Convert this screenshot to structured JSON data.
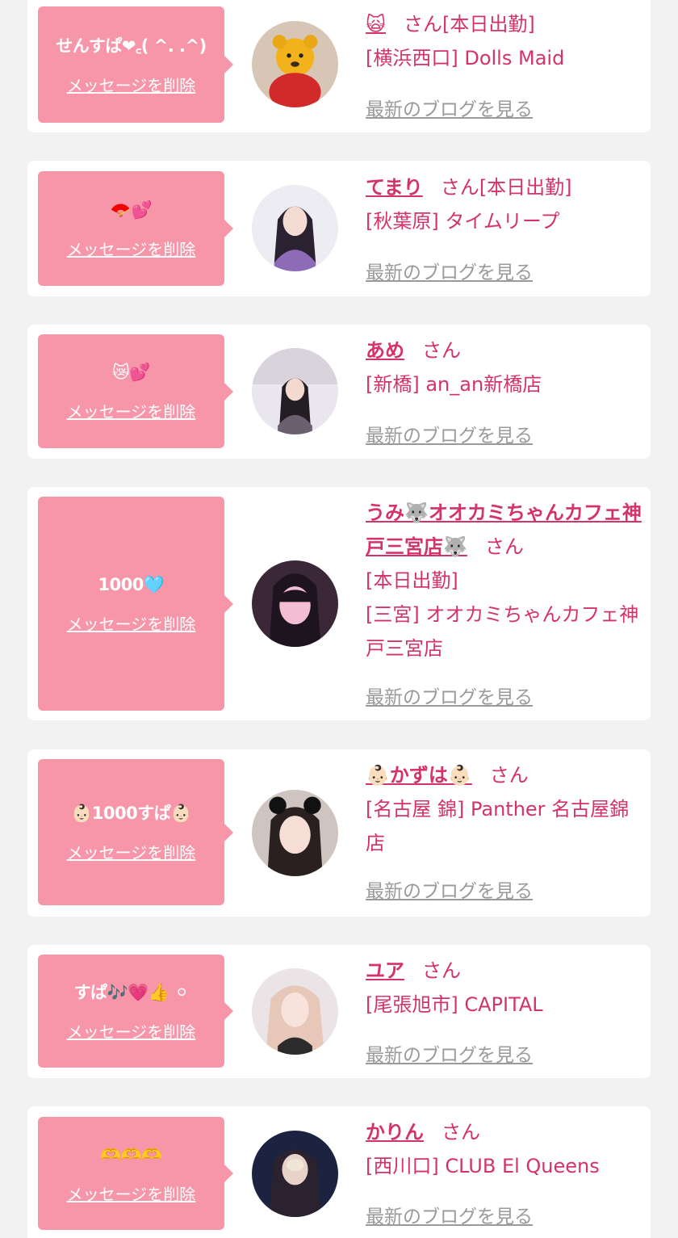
{
  "delete_label": "メッセージを削除",
  "blog_label": "最新のブログを見る",
  "honorific": "さん",
  "colors": {
    "page_bg": "#f2f2f2",
    "bubble": "#f795a9",
    "accent": "#d4336a",
    "muted": "#9a9a9a"
  },
  "entries": [
    {
      "message": "せんすぱ❤︎꜀( ^. .^)",
      "name": "🙀",
      "status": "[本日出勤]",
      "shop": "[横浜西口] Dolls Maid",
      "avatar_icon": "bear-plush-avatar"
    },
    {
      "message": "🪭💕",
      "name": "てまり",
      "status": "[本日出勤]",
      "shop": "[秋葉原] タイムリープ",
      "avatar_icon": "girl-avatar"
    },
    {
      "message": "😿💕",
      "name": "あめ",
      "status": "",
      "shop": "[新橋] an_an新橋店",
      "avatar_icon": "girl-avatar"
    },
    {
      "message": "1000🩵",
      "name": "うみ🐺オオカミちゃんカフェ神戸三宮店🐺",
      "status": "[本日出勤]",
      "shop": "[三宮] オオカミちゃんカフェ神戸三宮店",
      "avatar_icon": "girl-avatar"
    },
    {
      "message": "👶🏻1000すぱ👶🏻",
      "name": "👶🏻かずは👶🏻",
      "status": "",
      "shop": "[名古屋 錦] Panther 名古屋錦店",
      "avatar_icon": "girl-avatar"
    },
    {
      "message": "すぱ🎶💗👍 ⚪",
      "name": "ユア",
      "status": "",
      "shop": "[尾張旭市] CAPITAL",
      "avatar_icon": "girl-avatar"
    },
    {
      "message": "🫶🫶🫶",
      "name": "かりん",
      "status": "",
      "shop": "[西川口] CLUB El Queens",
      "avatar_icon": "girl-avatar"
    }
  ]
}
